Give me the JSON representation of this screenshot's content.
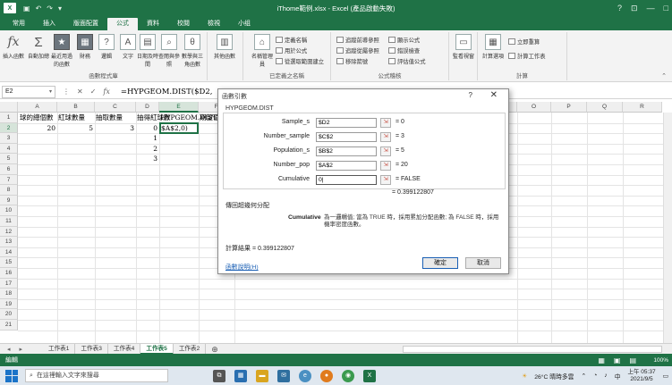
{
  "window": {
    "title": "iThome範例.xlsx - Excel (產品啟動失敗)",
    "logo": "X",
    "controls": [
      "?",
      "⊡",
      "—",
      "□"
    ]
  },
  "ribbon_tabs": [
    "常用",
    "插入",
    "版面配置",
    "公式",
    "資料",
    "校閱",
    "檢視",
    "小组"
  ],
  "active_tab": "公式",
  "ribbon": {
    "insert_function": "插入函數",
    "autosum": "自動加總",
    "recent": "最近用過的函數",
    "financial": "財務",
    "logical": "邏輯",
    "text": "文字",
    "datetime": "日期及時間",
    "lookup": "查閱與參照",
    "math": "數學與三角函數",
    "more": "其他函數",
    "group_library": "函數程式庫",
    "name_manager": "名稱管理員",
    "define_name": "定義名稱",
    "use_in_formula": "用於公式",
    "create_from_selection": "從選取範圍建立",
    "group_names": "已定義之名稱",
    "trace_precedents": "追蹤前導參照",
    "trace_dependents": "追蹤從屬參照",
    "remove_arrows": "移除箭號",
    "show_formulas": "顯示公式",
    "error_checking": "錯誤檢查",
    "evaluate_formula": "評估值公式",
    "watch_window": "監看視窗",
    "group_auditing": "公式稽核",
    "calc_options": "計算選項",
    "calc_now": "立即重算",
    "calc_sheet": "計算工作表",
    "group_calc": "計算"
  },
  "formula_bar": {
    "name_box": "E2",
    "formula": "=HYPGEOM.DIST($D2,"
  },
  "grid": {
    "columns": [
      "A",
      "B",
      "C",
      "D",
      "E",
      "F",
      "G",
      "H",
      "I",
      "J",
      "K",
      "L",
      "M",
      "N",
      "O",
      "P",
      "Q",
      "R"
    ],
    "rows": [
      "1",
      "2",
      "3",
      "4",
      "5",
      "6",
      "7",
      "8",
      "9",
      "10",
      "11",
      "12",
      "13",
      "14",
      "15",
      "16",
      "17",
      "18",
      "19",
      "20",
      "21"
    ],
    "cells": {
      "A1": "球的總個數",
      "B1": "紅球數量",
      "C1": "抽取數量",
      "D1": "抽得紅球數",
      "E1": "HYPGEOM.DIST(X)",
      "F1": "期望值",
      "A2": "20",
      "B2": "5",
      "C2": "3",
      "D2": "0",
      "E2": "$A$2,0)",
      "D3": "1",
      "D4": "2",
      "D5": "3"
    }
  },
  "dialog": {
    "title": "函數引數",
    "help": "?",
    "close": "✕",
    "function_name": "HYPGEOM.DIST",
    "args": [
      {
        "label": "Sample_s",
        "value": "$D2",
        "result": "=  0"
      },
      {
        "label": "Number_sample",
        "value": "$C$2",
        "result": "=  3"
      },
      {
        "label": "Population_s",
        "value": "$B$2",
        "result": "=  5"
      },
      {
        "label": "Number_pop",
        "value": "$A$2",
        "result": "=  20"
      },
      {
        "label": "Cumulative",
        "value": "0|",
        "result": "=  FALSE"
      }
    ],
    "total": "=  0.399122807",
    "description": "傳回超幾何分配",
    "arg_name": "Cumulative",
    "arg_description": "為一邏輯值; 當為 TRUE 時，採用累加分配函數; 為 FALSE 時，採用機率密度函數。",
    "result_label": "計算結果 =  0.399122807",
    "help_link": "函數說明(H)",
    "ok": "確定",
    "cancel": "取消"
  },
  "sheet_tabs": [
    "工作表1",
    "工作表3",
    "工作表4",
    "工作表5",
    "工作表2"
  ],
  "active_sheet": "工作表5",
  "status": {
    "mode": "編輯",
    "zoom": "100%"
  },
  "taskbar": {
    "search_placeholder": "在這裡輸入文字來搜尋",
    "weather": "26°C 晴時多雲",
    "time": "上午 05:37",
    "date": "2021/9/5",
    "ime": "中"
  }
}
